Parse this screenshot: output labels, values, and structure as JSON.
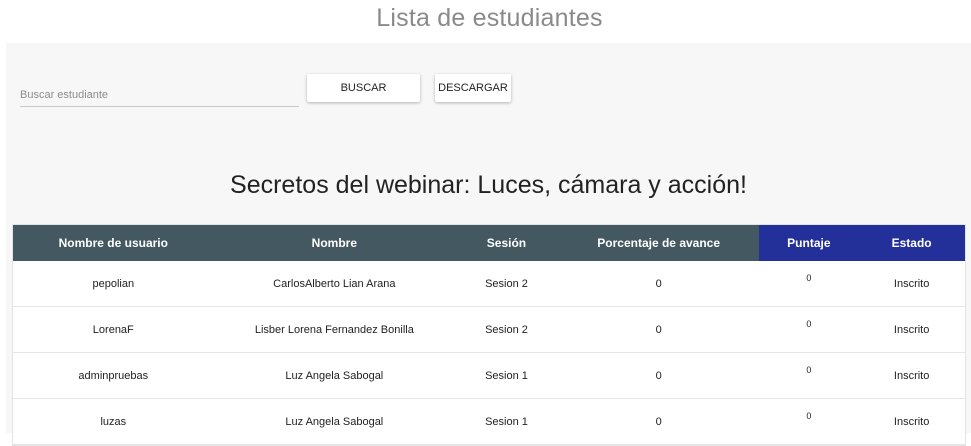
{
  "page": {
    "title": "Lista de estudiantes"
  },
  "toolbar": {
    "search_placeholder": "Buscar estudiante",
    "search_value": "",
    "search_button": "BUSCAR",
    "download_button": "DESCARGAR"
  },
  "course": {
    "title": "Secretos del webinar: Luces, cámara y acción!"
  },
  "colors": {
    "header_bg": "#445861",
    "header_highlight_bg": "#23309a",
    "panel_bg": "#f7f7f7"
  },
  "table": {
    "headers": [
      "Nombre de usuario",
      "Nombre",
      "Sesión",
      "Porcentaje de avance",
      "Puntaje",
      "Estado"
    ],
    "rows": [
      [
        "pepolian",
        "CarlosAlberto Lian Arana",
        "Sesion 2",
        "0",
        "0",
        "Inscrito"
      ],
      [
        "LorenaF",
        "Lisber Lorena Fernandez Bonilla",
        "Sesion 2",
        "0",
        "0",
        "Inscrito"
      ],
      [
        "adminpruebas",
        "Luz Angela Sabogal",
        "Sesion 1",
        "0",
        "0",
        "Inscrito"
      ],
      [
        "luzas",
        "Luz Angela Sabogal",
        "Sesion 1",
        "0",
        "0",
        "Inscrito"
      ]
    ]
  }
}
